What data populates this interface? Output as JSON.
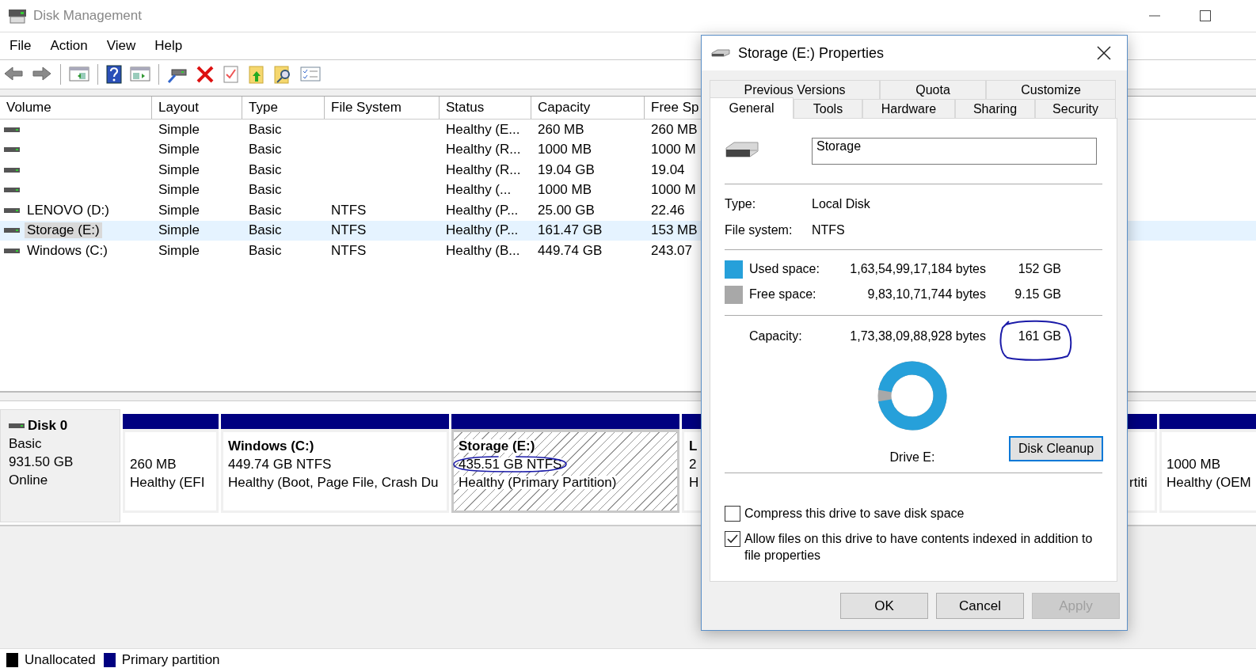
{
  "window": {
    "title": "Disk Management"
  },
  "menu": [
    "File",
    "Action",
    "View",
    "Help"
  ],
  "volumes": {
    "columns": [
      "Volume",
      "Layout",
      "Type",
      "File System",
      "Status",
      "Capacity",
      "Free Sp"
    ],
    "rows": [
      {
        "layout": "Simple",
        "type": "Basic",
        "status": "Healthy (E...",
        "capacity": "260 MB",
        "free": "260 MB",
        "selected": false
      },
      {
        "layout": "Simple",
        "type": "Basic",
        "status": "Healthy (R...",
        "capacity": "1000 MB",
        "free": "1000 M",
        "selected": false
      },
      {
        "layout": "Simple",
        "type": "Basic",
        "status": "Healthy (R...",
        "capacity": "19.04 GB",
        "free": "19.04",
        "selected": false
      },
      {
        "layout": "Simple",
        "type": "Basic",
        "status": "Healthy (...",
        "capacity": "1000 MB",
        "free": "1000 M",
        "selected": false
      },
      {
        "volume": "LENOVO (D:)",
        "layout": "Simple",
        "type": "Basic",
        "file_system": "NTFS",
        "status": "Healthy (P...",
        "capacity": "25.00 GB",
        "free": "22.46",
        "selected": false
      },
      {
        "volume": "Storage (E:)",
        "layout": "Simple",
        "type": "Basic",
        "file_system": "NTFS",
        "status": "Healthy (P...",
        "capacity": "161.47 GB",
        "free": "153 MB",
        "selected": true
      },
      {
        "volume": "Windows (C:)",
        "layout": "Simple",
        "type": "Basic",
        "file_system": "NTFS",
        "status": "Healthy (B...",
        "capacity": "449.74 GB",
        "free": "243.07",
        "selected": false
      }
    ]
  },
  "disk": {
    "name": "Disk 0",
    "type": "Basic",
    "size": "931.50 GB",
    "status": "Online"
  },
  "partitions": [
    {
      "lines": [
        "260 MB",
        "Healthy (EFI"
      ],
      "selected": false
    },
    {
      "title": "Windows  (C:)",
      "lines": [
        "449.74 GB NTFS",
        "Healthy (Boot, Page File, Crash Du"
      ],
      "selected": false
    },
    {
      "title": "Storage  (E:)",
      "lines": [
        "435.51 GB NTFS",
        "Healthy (Primary Partition)"
      ],
      "selected": true
    },
    {
      "title": "L",
      "lines": [
        "2",
        "H"
      ],
      "selected": false
    },
    {
      "lines": [
        "rtiti"
      ],
      "selected": false
    },
    {
      "lines": [
        "1000 MB",
        "Healthy (OEM"
      ],
      "selected": false
    }
  ],
  "legend": [
    {
      "label": "Unallocated",
      "color": "#000000"
    },
    {
      "label": "Primary partition",
      "color": "#000080"
    }
  ],
  "dialog": {
    "title": "Storage (E:) Properties",
    "tabs_back": [
      {
        "label": "Previous Versions",
        "selected": false
      },
      {
        "label": "Quota",
        "selected": false
      },
      {
        "label": "Customize",
        "selected": false
      }
    ],
    "tabs_front": [
      {
        "label": "General",
        "selected": true
      },
      {
        "label": "Tools",
        "selected": false
      },
      {
        "label": "Hardware",
        "selected": false
      },
      {
        "label": "Sharing",
        "selected": false
      },
      {
        "label": "Security",
        "selected": false
      }
    ],
    "name_field": {
      "value": "Storage"
    },
    "info": [
      {
        "label": "Type:",
        "value": "Local Disk"
      },
      {
        "label": "File system:",
        "value": "NTFS"
      }
    ],
    "space": [
      {
        "label": "Used space:",
        "bytes": "1,63,54,99,17,184 bytes",
        "size": "152 GB",
        "color": "#26a0da"
      },
      {
        "label": "Free space:",
        "bytes": "9,83,10,71,744 bytes",
        "size": "9.15 GB",
        "color": "#a8a8a8"
      }
    ],
    "capacity": {
      "label": "Capacity:",
      "bytes": "1,73,38,09,88,928 bytes",
      "size": "161 GB"
    },
    "donut": {
      "level": 0.944
    },
    "drive_label": "Drive E:",
    "cleanup_button": "Disk Cleanup",
    "checkboxes": [
      {
        "label": "Compress this drive to save disk space",
        "checked": false
      },
      {
        "label": "Allow files on this drive to have contents indexed in addition to file properties",
        "checked": true
      }
    ],
    "buttons": [
      {
        "label": "OK",
        "disabled": false
      },
      {
        "label": "Cancel",
        "disabled": false
      },
      {
        "label": "Apply",
        "disabled": true
      }
    ]
  }
}
